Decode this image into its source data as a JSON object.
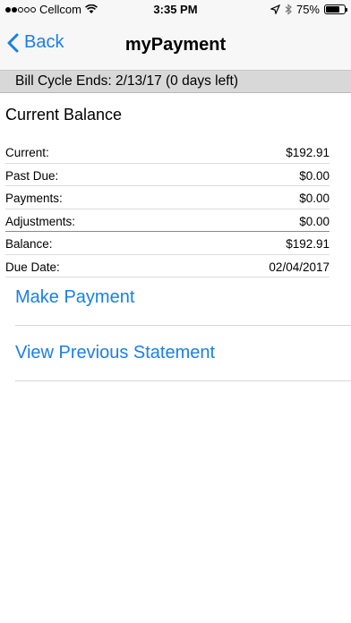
{
  "status_bar": {
    "carrier": "Cellcom",
    "time": "3:35 PM",
    "battery": "75%",
    "battery_level": 0.75,
    "signal_dots_filled": 2,
    "signal_dots_total": 5
  },
  "nav": {
    "back_label": "Back",
    "title": "myPayment"
  },
  "banner": {
    "text": "Bill Cycle Ends: 2/13/17 (0 days left)"
  },
  "balance": {
    "title": "Current Balance",
    "rows": [
      {
        "label": "Current:",
        "value": "$192.91"
      },
      {
        "label": "Past Due:",
        "value": "$0.00"
      },
      {
        "label": "Payments:",
        "value": "$0.00"
      },
      {
        "label": "Adjustments:",
        "value": "$0.00"
      },
      {
        "label": "Balance:",
        "value": "$192.91"
      },
      {
        "label": "Due Date:",
        "value": "02/04/2017"
      }
    ]
  },
  "actions": {
    "make_payment": "Make Payment",
    "view_previous": "View Previous Statement"
  },
  "colors": {
    "accent": "#1a7fe6",
    "banner_bg": "#d8d8d8"
  }
}
